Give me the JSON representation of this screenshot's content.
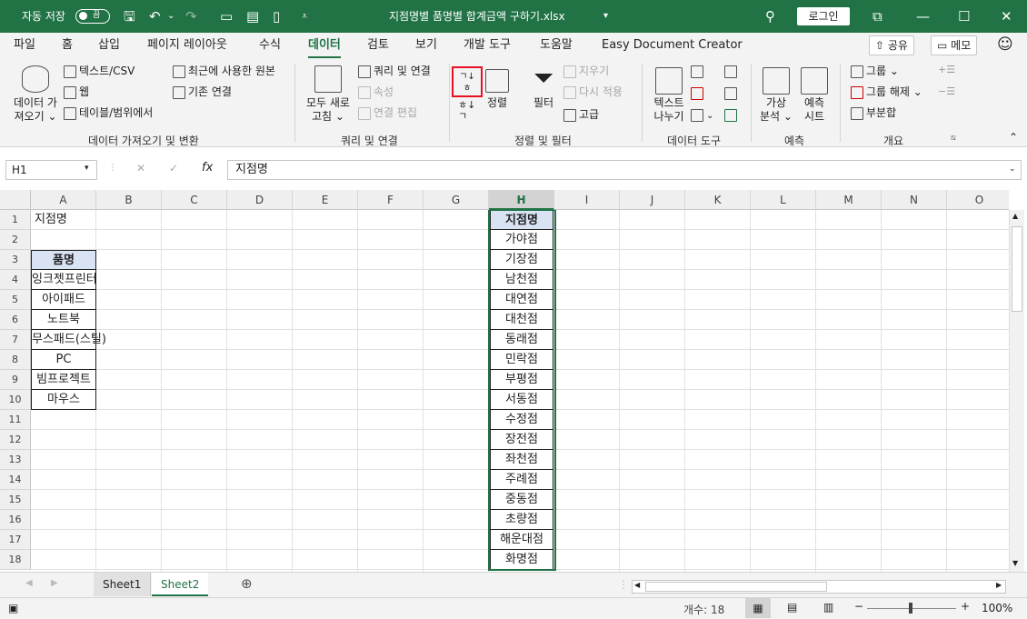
{
  "titlebar": {
    "autosave_label": "자동 저장",
    "autosave_state": "끔",
    "doc_title": "지점명별 품명별 합계금액 구하기.xlsx",
    "login_label": "로그인"
  },
  "menu": {
    "tabs": [
      "파일",
      "홈",
      "삽입",
      "페이지 레이아웃",
      "수식",
      "데이터",
      "검토",
      "보기",
      "개발 도구",
      "도움말",
      "Easy Document Creator"
    ],
    "active": "데이터",
    "share_label": "공유",
    "memo_label": "메모"
  },
  "ribbon": {
    "get_data": {
      "big_label_1": "데이터 가",
      "big_label_2": "져오기",
      "text_csv": "텍스트/CSV",
      "web": "웹",
      "table_range": "테이블/범위에서",
      "recent": "최근에 사용한 원본",
      "existing": "기존 연결",
      "group_label": "데이터 가져오기 및 변환"
    },
    "queries": {
      "refresh_1": "모두 새로",
      "refresh_2": "고침",
      "queries_conn": "쿼리 및 연결",
      "properties": "속성",
      "edit_links": "연결 편집",
      "group_label": "쿼리 및 연결"
    },
    "sort_filter": {
      "sort_az": "정렬",
      "filter": "필터",
      "clear": "지우기",
      "reapply": "다시 적용",
      "advanced": "고급",
      "group_label": "정렬 및 필터"
    },
    "data_tools": {
      "text_to_col_1": "텍스트",
      "text_to_col_2": "나누기",
      "group_label": "데이터 도구"
    },
    "forecast": {
      "whatif_1": "가상",
      "whatif_2": "분석",
      "sheet_1": "예측",
      "sheet_2": "시트",
      "group_label": "예측"
    },
    "outline": {
      "group": "그룹",
      "ungroup": "그룹 해제",
      "subtotal": "부분합",
      "group_label": "개요"
    }
  },
  "formula_bar": {
    "name_box": "H1",
    "formula": "지점명"
  },
  "columns": [
    "A",
    "B",
    "C",
    "D",
    "E",
    "F",
    "G",
    "H",
    "I",
    "J",
    "K",
    "L",
    "M",
    "N",
    "O"
  ],
  "rows": [
    "1",
    "2",
    "3",
    "4",
    "5",
    "6",
    "7",
    "8",
    "9",
    "10",
    "11",
    "12",
    "13",
    "14",
    "15",
    "16",
    "17",
    "18"
  ],
  "colA": [
    "지점명",
    "",
    "품명",
    "잉크젯프린터",
    "아이패드",
    "노트북",
    "무스패드(스틸)",
    "PC",
    "빔프로젝트",
    "마우스"
  ],
  "colH": [
    "지점명",
    "가야점",
    "기장점",
    "남천점",
    "대연점",
    "대천점",
    "동래점",
    "민락점",
    "부평점",
    "서동점",
    "수정점",
    "장전점",
    "좌천점",
    "주례점",
    "중동점",
    "초량점",
    "해운대점",
    "화명점"
  ],
  "sheets": [
    "Sheet1",
    "Sheet2"
  ],
  "active_sheet": "Sheet2",
  "status": {
    "count": "개수: 18",
    "zoom": "100%"
  },
  "colors": {
    "accent": "#217346",
    "header_fill": "#dae3f3",
    "selected_border": "#217346"
  }
}
